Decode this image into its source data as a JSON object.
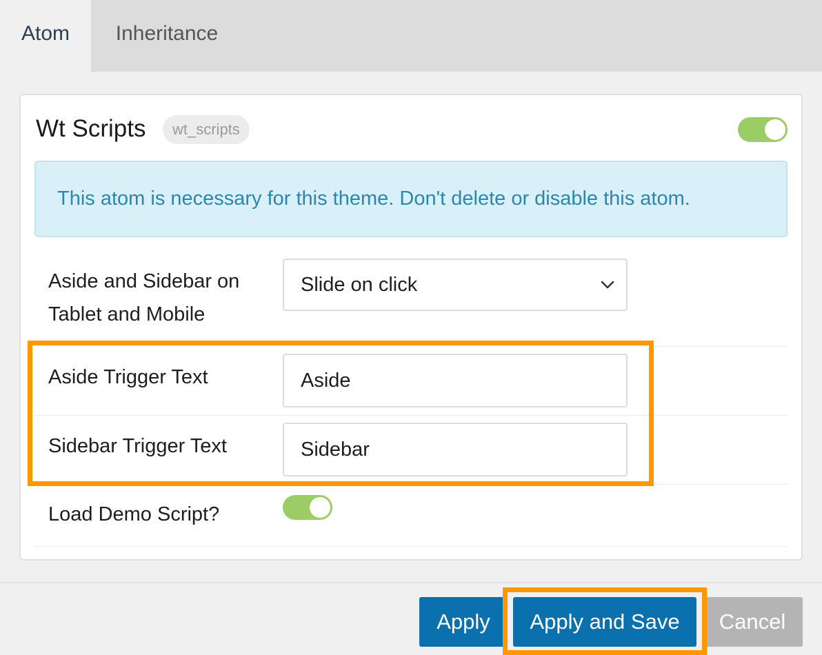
{
  "tabs": [
    {
      "label": "Atom",
      "active": true
    },
    {
      "label": "Inheritance",
      "active": false
    }
  ],
  "panel": {
    "title": "Wt Scripts",
    "slug": "wt_scripts",
    "enabled": true,
    "notice": "This atom is necessary for this theme. Don't delete or disable this atom.",
    "fields": {
      "aside_sidebar_mode": {
        "label_line1": "Aside and Sidebar on",
        "label_line2": "Tablet and Mobile",
        "value": "Slide on click"
      },
      "aside_trigger": {
        "label": "Aside Trigger Text",
        "value": "Aside"
      },
      "sidebar_trigger": {
        "label": "Sidebar Trigger Text",
        "value": "Sidebar"
      },
      "demo_script": {
        "label": "Load Demo Script?",
        "enabled": true
      }
    }
  },
  "footer": {
    "apply_label": "Apply",
    "apply_save_label": "Apply and Save",
    "cancel_label": "Cancel"
  },
  "colors": {
    "accent": "#0a71ae",
    "toggle_on": "#9ccc65",
    "highlight": "#ff9800",
    "notice_bg": "#d9f0f8",
    "notice_text": "#2b87ad"
  },
  "icons": {
    "select_arrow": "chevron-down-icon"
  }
}
